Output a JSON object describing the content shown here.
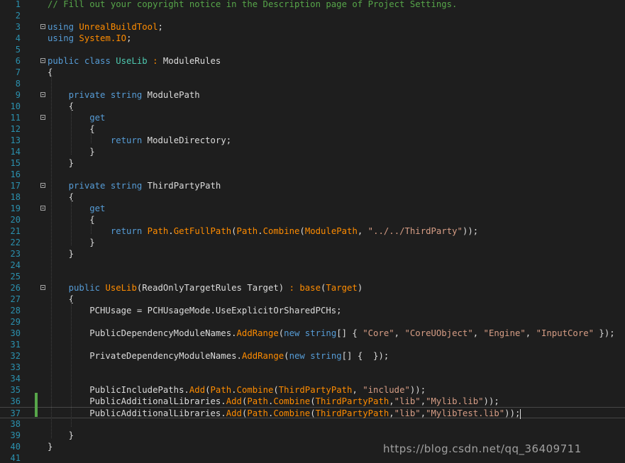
{
  "editor": {
    "lines": [
      {
        "n": "1",
        "tokens": [
          {
            "t": "// Fill out your copyright notice in the Description page of Project Settings.",
            "c": "cm"
          }
        ]
      },
      {
        "n": "2",
        "tokens": []
      },
      {
        "n": "3",
        "fold": true,
        "tokens": [
          {
            "t": "using ",
            "c": "kw"
          },
          {
            "t": "UnrealBuildTool",
            "c": "fn"
          },
          {
            "t": ";"
          }
        ]
      },
      {
        "n": "4",
        "tokens": [
          {
            "t": "using ",
            "c": "kw"
          },
          {
            "t": "System.IO",
            "c": "fn"
          },
          {
            "t": ";"
          }
        ]
      },
      {
        "n": "5",
        "tokens": []
      },
      {
        "n": "6",
        "fold": true,
        "tokens": [
          {
            "t": "public ",
            "c": "kw"
          },
          {
            "t": "class ",
            "c": "kw"
          },
          {
            "t": "UseLib",
            "c": "ty"
          },
          {
            "t": " : ",
            "c": "fn"
          },
          {
            "t": "ModuleRules"
          }
        ]
      },
      {
        "n": "7",
        "tokens": [
          {
            "t": "{"
          }
        ]
      },
      {
        "n": "8",
        "tokens": []
      },
      {
        "n": "9",
        "fold": true,
        "tokens": [
          {
            "t": "    private ",
            "c": "kw"
          },
          {
            "t": "string ",
            "c": "kw"
          },
          {
            "t": "ModulePath"
          }
        ]
      },
      {
        "n": "10",
        "tokens": [
          {
            "t": "    {"
          }
        ]
      },
      {
        "n": "11",
        "fold": true,
        "tokens": [
          {
            "t": "        get",
            "c": "kw"
          }
        ]
      },
      {
        "n": "12",
        "tokens": [
          {
            "t": "        {"
          }
        ]
      },
      {
        "n": "13",
        "tokens": [
          {
            "t": "            return ",
            "c": "kw"
          },
          {
            "t": "ModuleDirectory;"
          }
        ]
      },
      {
        "n": "14",
        "tokens": [
          {
            "t": "        }"
          }
        ]
      },
      {
        "n": "15",
        "tokens": [
          {
            "t": "    }"
          }
        ]
      },
      {
        "n": "16",
        "tokens": []
      },
      {
        "n": "17",
        "fold": true,
        "tokens": [
          {
            "t": "    private ",
            "c": "kw"
          },
          {
            "t": "string ",
            "c": "kw"
          },
          {
            "t": "ThirdPartyPath"
          }
        ]
      },
      {
        "n": "18",
        "tokens": [
          {
            "t": "    {"
          }
        ]
      },
      {
        "n": "19",
        "fold": true,
        "tokens": [
          {
            "t": "        get",
            "c": "kw"
          }
        ]
      },
      {
        "n": "20",
        "tokens": [
          {
            "t": "        {"
          }
        ]
      },
      {
        "n": "21",
        "tokens": [
          {
            "t": "            return ",
            "c": "kw"
          },
          {
            "t": "Path",
            "c": "fn"
          },
          {
            "t": "."
          },
          {
            "t": "GetFullPath",
            "c": "fn"
          },
          {
            "t": "("
          },
          {
            "t": "Path",
            "c": "fn"
          },
          {
            "t": "."
          },
          {
            "t": "Combine",
            "c": "fn"
          },
          {
            "t": "("
          },
          {
            "t": "ModulePath",
            "c": "fn"
          },
          {
            "t": ", "
          },
          {
            "t": "\"../../ThirdParty\"",
            "c": "str"
          },
          {
            "t": "));"
          }
        ]
      },
      {
        "n": "22",
        "tokens": [
          {
            "t": "        }"
          }
        ]
      },
      {
        "n": "23",
        "tokens": [
          {
            "t": "    }"
          }
        ]
      },
      {
        "n": "24",
        "tokens": []
      },
      {
        "n": "25",
        "tokens": []
      },
      {
        "n": "26",
        "fold": true,
        "tokens": [
          {
            "t": "    public ",
            "c": "kw"
          },
          {
            "t": "UseLib",
            "c": "fn"
          },
          {
            "t": "(ReadOnlyTargetRules Target) "
          },
          {
            "t": ": ",
            "c": "fn"
          },
          {
            "t": "base",
            "c": "fn"
          },
          {
            "t": "("
          },
          {
            "t": "Target",
            "c": "fn"
          },
          {
            "t": ")"
          }
        ]
      },
      {
        "n": "27",
        "tokens": [
          {
            "t": "    {"
          }
        ]
      },
      {
        "n": "28",
        "tokens": [
          {
            "t": "        PCHUsage = PCHUsageMode.UseExplicitOrSharedPCHs;"
          }
        ]
      },
      {
        "n": "29",
        "tokens": []
      },
      {
        "n": "30",
        "tokens": [
          {
            "t": "        PublicDependencyModuleNames."
          },
          {
            "t": "AddRange",
            "c": "fn"
          },
          {
            "t": "("
          },
          {
            "t": "new ",
            "c": "kw"
          },
          {
            "t": "string",
            "c": "kw"
          },
          {
            "t": "[] { "
          },
          {
            "t": "\"Core\"",
            "c": "str"
          },
          {
            "t": ", "
          },
          {
            "t": "\"CoreUObject\"",
            "c": "str"
          },
          {
            "t": ", "
          },
          {
            "t": "\"Engine\"",
            "c": "str"
          },
          {
            "t": ", "
          },
          {
            "t": "\"InputCore\"",
            "c": "str"
          },
          {
            "t": " });"
          }
        ]
      },
      {
        "n": "31",
        "tokens": []
      },
      {
        "n": "32",
        "tokens": [
          {
            "t": "        PrivateDependencyModuleNames."
          },
          {
            "t": "AddRange",
            "c": "fn"
          },
          {
            "t": "("
          },
          {
            "t": "new ",
            "c": "kw"
          },
          {
            "t": "string",
            "c": "kw"
          },
          {
            "t": "[] {  });"
          }
        ]
      },
      {
        "n": "33",
        "tokens": []
      },
      {
        "n": "34",
        "tokens": []
      },
      {
        "n": "35",
        "tokens": [
          {
            "t": "        PublicIncludePaths."
          },
          {
            "t": "Add",
            "c": "fn"
          },
          {
            "t": "("
          },
          {
            "t": "Path",
            "c": "fn"
          },
          {
            "t": "."
          },
          {
            "t": "Combine",
            "c": "fn"
          },
          {
            "t": "("
          },
          {
            "t": "ThirdPartyPath",
            "c": "fn"
          },
          {
            "t": ", "
          },
          {
            "t": "\"include\"",
            "c": "str"
          },
          {
            "t": "));"
          }
        ]
      },
      {
        "n": "36",
        "tokens": [
          {
            "t": "        PublicAdditionalLibraries."
          },
          {
            "t": "Add",
            "c": "fn"
          },
          {
            "t": "("
          },
          {
            "t": "Path",
            "c": "fn"
          },
          {
            "t": "."
          },
          {
            "t": "Combine",
            "c": "fn"
          },
          {
            "t": "("
          },
          {
            "t": "ThirdPartyPath",
            "c": "fn"
          },
          {
            "t": ","
          },
          {
            "t": "\"lib\"",
            "c": "str"
          },
          {
            "t": ","
          },
          {
            "t": "\"Mylib.lib\"",
            "c": "str"
          },
          {
            "t": "));"
          }
        ]
      },
      {
        "n": "37",
        "current": true,
        "tokens": [
          {
            "t": "        PublicAdditionalLibraries."
          },
          {
            "t": "Add",
            "c": "fn"
          },
          {
            "t": "("
          },
          {
            "t": "Path",
            "c": "fn"
          },
          {
            "t": "."
          },
          {
            "t": "Combine",
            "c": "fn"
          },
          {
            "t": "("
          },
          {
            "t": "ThirdPartyPath",
            "c": "fn"
          },
          {
            "t": ","
          },
          {
            "t": "\"lib\"",
            "c": "str"
          },
          {
            "t": ","
          },
          {
            "t": "\"MylibTest.lib\"",
            "c": "str"
          },
          {
            "t": "));"
          }
        ]
      },
      {
        "n": "38",
        "tokens": []
      },
      {
        "n": "39",
        "tokens": [
          {
            "t": "    }"
          }
        ]
      },
      {
        "n": "40",
        "tokens": [
          {
            "t": "}"
          }
        ]
      },
      {
        "n": "41",
        "tokens": []
      }
    ]
  },
  "watermark": "https://blog.csdn.net/qq_36409711",
  "colors": {
    "background": "#1e1e1e",
    "line_number": "#2b91af",
    "comment": "#57a64a",
    "keyword": "#569cd6",
    "type": "#4ec9b0",
    "method": "#ff8c00",
    "string": "#d69d85",
    "text": "#dcdcdc"
  }
}
